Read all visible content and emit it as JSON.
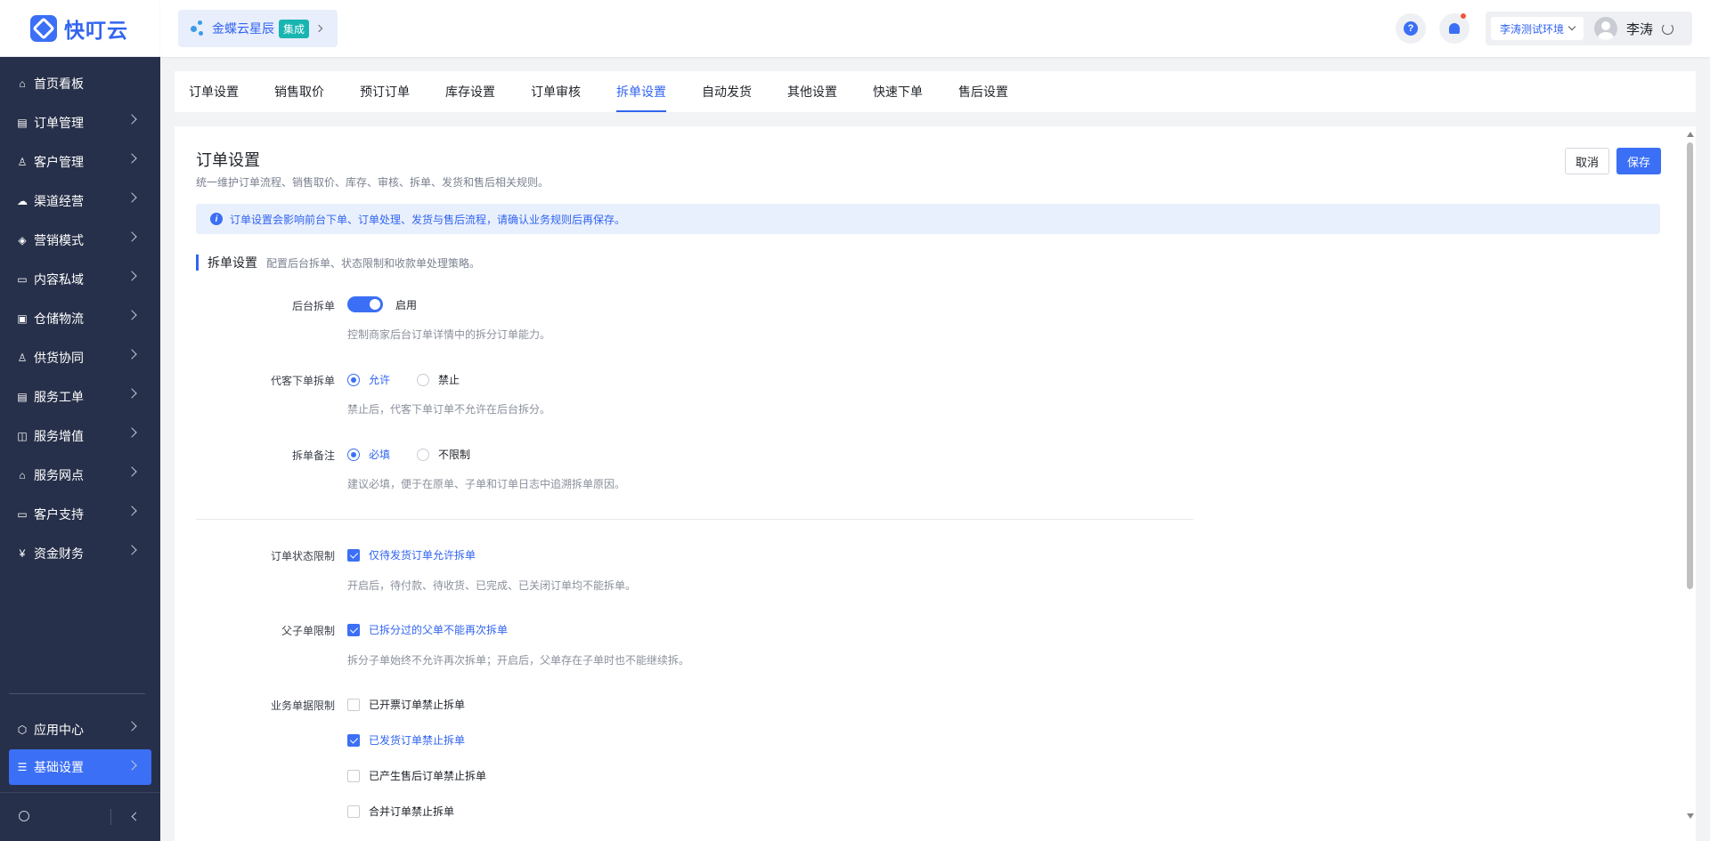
{
  "brand": {
    "name": "快叮云"
  },
  "app_switch": {
    "label": "金蝶云星辰",
    "badge": "集成"
  },
  "header": {
    "env": "李涛测试环境",
    "user": "李涛",
    "help": "?"
  },
  "sidebar": {
    "items": [
      {
        "label": "首页看板",
        "icon": "home-icon"
      },
      {
        "label": "订单管理",
        "icon": "clipboard-icon"
      },
      {
        "label": "客户管理",
        "icon": "user-icon"
      },
      {
        "label": "渠道经营",
        "icon": "channel-icon"
      },
      {
        "label": "营销模式",
        "icon": "tag-icon"
      },
      {
        "label": "内容私域",
        "icon": "image-icon"
      },
      {
        "label": "仓储物流",
        "icon": "box-icon"
      },
      {
        "label": "供货协同",
        "icon": "supplier-icon"
      },
      {
        "label": "服务工单",
        "icon": "workorder-icon"
      },
      {
        "label": "服务增值",
        "icon": "bag-icon"
      },
      {
        "label": "服务网点",
        "icon": "store-icon"
      },
      {
        "label": "客户支持",
        "icon": "support-icon"
      },
      {
        "label": "资金财务",
        "icon": "yuan-icon"
      }
    ],
    "bottom_items": [
      {
        "label": "应用中心",
        "icon": "cube-icon"
      },
      {
        "label": "基础设置",
        "icon": "sliders-icon"
      }
    ]
  },
  "tabs": [
    "订单设置",
    "销售取价",
    "预订订单",
    "库存设置",
    "订单审核",
    "拆单设置",
    "自动发货",
    "其他设置",
    "快速下单",
    "售后设置"
  ],
  "active_tab": 5,
  "page": {
    "title": "订单设置",
    "subtitle": "统一维护订单流程、销售取价、库存、审核、拆单、发货和售后相关规则。",
    "cancel": "取消",
    "save": "保存",
    "notice": "订单设置会影响前台下单、订单处理、发货与售后流程，请确认业务规则后再保存。"
  },
  "section": {
    "title": "拆单设置",
    "desc": "配置后台拆单、状态限制和收款单处理策略。"
  },
  "settings": {
    "backend_split": {
      "label": "后台拆单",
      "toggle_text": "启用",
      "enabled": true,
      "hint": "控制商家后台订单详情中的拆分订单能力。"
    },
    "proxy_split": {
      "label": "代客下单拆单",
      "options": [
        "允许",
        "禁止"
      ],
      "selected": "允许",
      "hint": "禁止后，代客下单订单不允许在后台拆分。"
    },
    "split_remark": {
      "label": "拆单备注",
      "options": [
        "必填",
        "不限制"
      ],
      "selected": "必填",
      "hint": "建议必填，便于在原单、子单和订单日志中追溯拆单原因。"
    },
    "status_limit": {
      "label": "订单状态限制",
      "option": "仅待发货订单允许拆单",
      "checked": true,
      "hint": "开启后，待付款、待收货、已完成、已关闭订单均不能拆单。"
    },
    "parent_limit": {
      "label": "父子单限制",
      "option": "已拆分过的父单不能再次拆单",
      "checked": true,
      "hint": "拆分子单始终不允许再次拆单；开启后，父单存在子单时也不能继续拆。"
    },
    "doc_limit": {
      "label": "业务单据限制",
      "options": [
        {
          "text": "已开票订单禁止拆单",
          "checked": false
        },
        {
          "text": "已发货订单禁止拆单",
          "checked": true
        },
        {
          "text": "已产生售后订单禁止拆单",
          "checked": false
        },
        {
          "text": "合并订单禁止拆单",
          "checked": false
        }
      ]
    }
  }
}
